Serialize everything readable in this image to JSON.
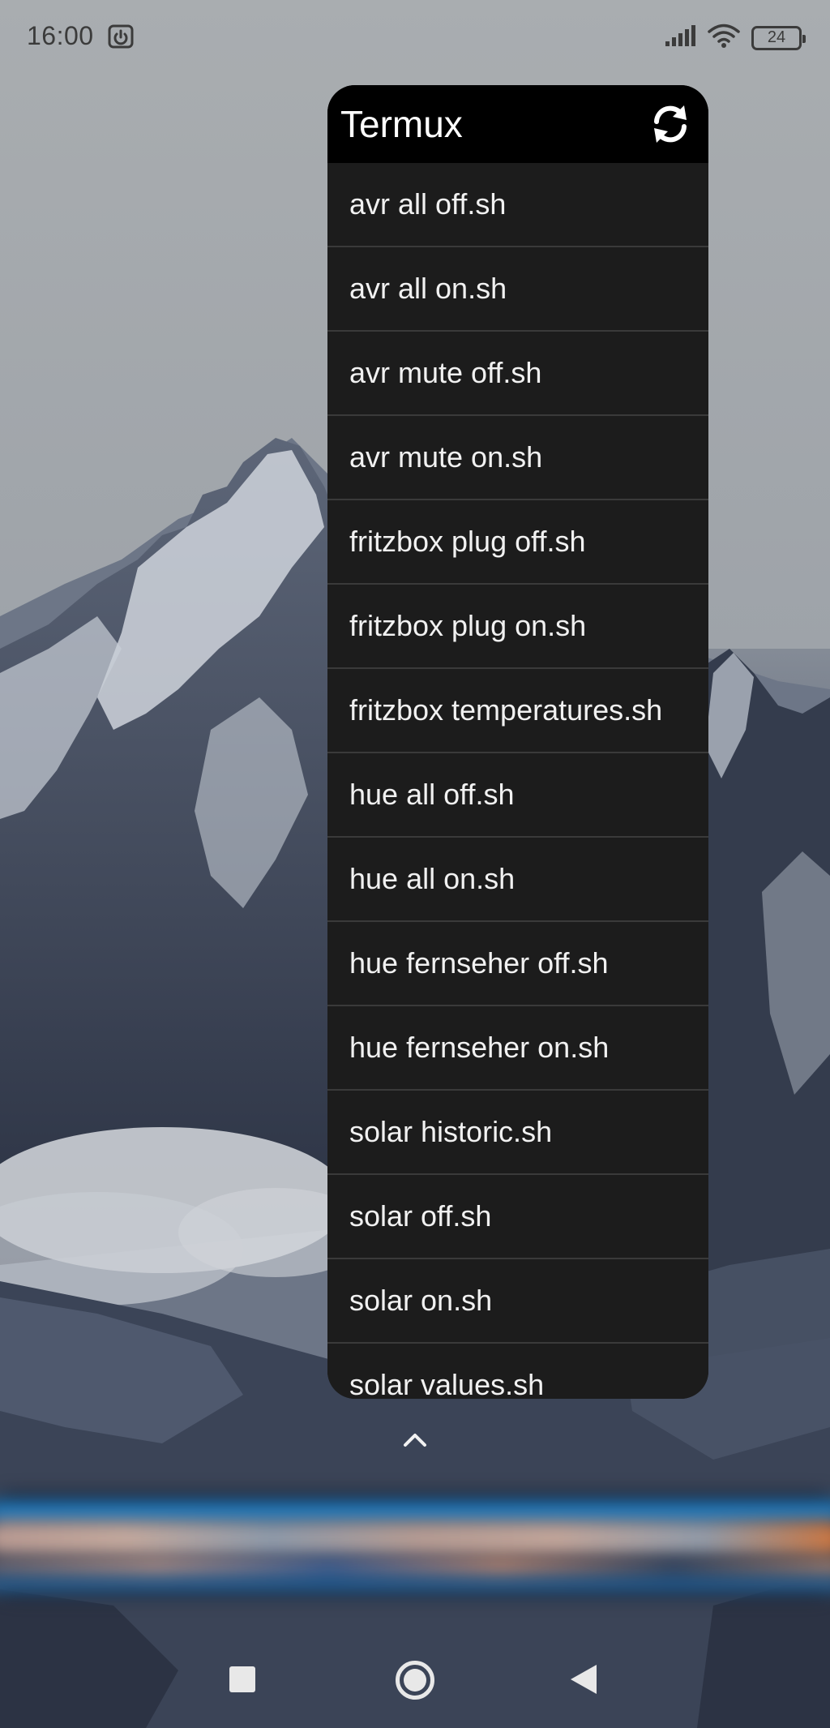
{
  "status_bar": {
    "time": "16:00",
    "battery_level": "24",
    "icons": [
      "power-icon",
      "signal-icon",
      "wifi-icon",
      "battery-icon"
    ]
  },
  "widget": {
    "title": "Termux",
    "refresh_icon": "refresh-icon",
    "items": [
      {
        "label": "avr all off.sh"
      },
      {
        "label": "avr all on.sh"
      },
      {
        "label": "avr mute off.sh"
      },
      {
        "label": "avr mute on.sh"
      },
      {
        "label": "fritzbox plug off.sh"
      },
      {
        "label": "fritzbox plug on.sh"
      },
      {
        "label": "fritzbox temperatures.sh"
      },
      {
        "label": "hue all off.sh"
      },
      {
        "label": "hue all on.sh"
      },
      {
        "label": "hue fernseher off.sh"
      },
      {
        "label": "hue fernseher on.sh"
      },
      {
        "label": "solar historic.sh"
      },
      {
        "label": "solar off.sh"
      },
      {
        "label": "solar on.sh"
      },
      {
        "label": "solar values.sh"
      }
    ]
  },
  "app_drawer_handle": "chevron-up-icon",
  "nav_bar": {
    "buttons": [
      "recents-button",
      "home-button",
      "back-button"
    ]
  },
  "colors": {
    "widget_header_bg": "#000000",
    "widget_list_bg": "#1c1c1c",
    "divider": "#3a3a3a",
    "text": "#f1f1f1"
  }
}
